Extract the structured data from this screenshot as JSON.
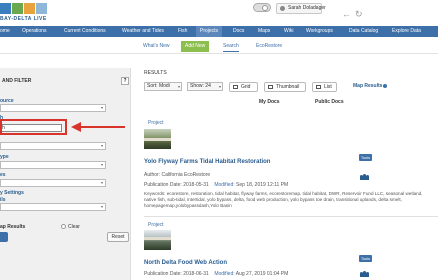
{
  "header": {
    "logo_text": "BAY-DELTA LIVE",
    "user_name": "Sarah Doladager"
  },
  "mainnav": {
    "items": [
      "ome",
      "Operations",
      "Current Conditions",
      "Weather and Tides",
      "Fish",
      "Projects",
      "Docs",
      "Maps",
      "Wiki",
      "Workgroups",
      "Data Catalog",
      "Explore Data"
    ],
    "active_index": 5
  },
  "subnav": {
    "items": [
      "What's New",
      "Add New",
      "Search",
      "EcoRestore"
    ]
  },
  "left_panel": {
    "title": "AND FILTER",
    "help": "?",
    "source_label": "ource",
    "search_label": "h",
    "search_value": "h",
    "type_label": "ype",
    "owner_label": "es",
    "settings_label": "y Settings",
    "settings_sub": "ils",
    "map_results_label": "ap Results",
    "clear_label": "Clear",
    "reset_label": "Reset"
  },
  "results": {
    "label": "RESULTS",
    "sort_value": "Sort: Modi",
    "show_value": "Show: 24",
    "grid_label": "Grid",
    "thumbnail_label": "Thumbnail",
    "list_label": "List",
    "map_results_label": "Map Results",
    "col_my_docs": "My Docs",
    "col_public_docs": "Public Docs",
    "items": [
      {
        "badge": "Project",
        "title": "Yolo Flyway Farms Tidal Habitat Restoration",
        "author": "Author: California EcoRestore",
        "pub_label": "Publication Date:",
        "pub_date": "2018-05-31",
        "mod_label": "Modified:",
        "mod_date": "Sep 18, 2019 12:11 PM",
        "keywords": "Keywords: ecorestore, restoration, tidal habitat, flyway farms, ecorestoremap, tidal habitat, DWR, Reservoir Fund LLC, seasonal wetland, native fish, sub-tidal, intertidal, yolo bypass, delta, food web production, yolo bypass toe drain, transitional uplands, delta smelt, homepagemap,yolobypassdash,Yolo Basin",
        "tools": "Tools"
      },
      {
        "badge": "Project",
        "title": "North Delta Food Web Action",
        "author": "",
        "pub_label": "Publication Date:",
        "pub_date": "2018-06-31",
        "mod_label": "Modified:",
        "mod_date": "Aug 27, 2019 01:04 PM",
        "keywords": "",
        "tools": "Tools"
      }
    ]
  }
}
